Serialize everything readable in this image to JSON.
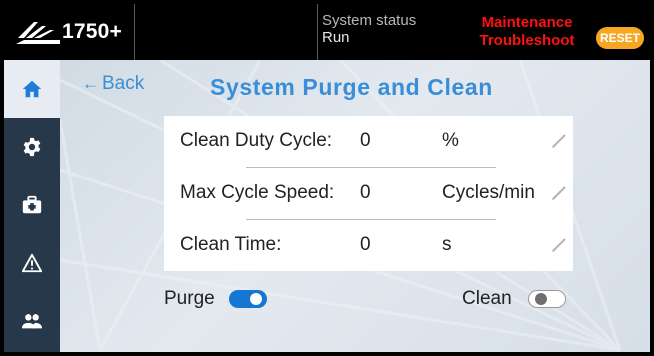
{
  "header": {
    "model": "1750+",
    "status_label": "System status",
    "status_value": "Run",
    "alert_line1": "Maintenance",
    "alert_line2": "Troubleshoot",
    "reset_label": "RESET"
  },
  "sidebar": {
    "items": [
      {
        "name": "home",
        "icon": "home-icon",
        "active": true
      },
      {
        "name": "settings",
        "icon": "gear-icon",
        "active": false
      },
      {
        "name": "maintenance",
        "icon": "toolbox-icon",
        "active": false
      },
      {
        "name": "alarms",
        "icon": "warning-icon",
        "active": false
      },
      {
        "name": "users",
        "icon": "users-icon",
        "active": false
      }
    ]
  },
  "page": {
    "back_label": "Back",
    "title": "System Purge and Clean"
  },
  "params": [
    {
      "label": "Clean Duty Cycle:",
      "value": "0",
      "unit": "%"
    },
    {
      "label": "Max Cycle Speed:",
      "value": "0",
      "unit": "Cycles/min"
    },
    {
      "label": "Clean Time:",
      "value": "0",
      "unit": "s"
    }
  ],
  "toggles": {
    "purge": {
      "label": "Purge",
      "state": "on"
    },
    "clean": {
      "label": "Clean",
      "state": "off"
    }
  },
  "colors": {
    "accent": "#3a8ed8",
    "alert": "#ff1010",
    "reset": "#f5a623",
    "sidebar": "#27384a",
    "toggle_on": "#1677d2"
  }
}
